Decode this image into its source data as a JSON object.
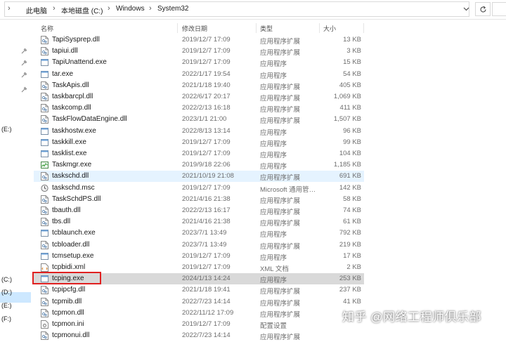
{
  "address": {
    "crumbs": [
      "此电脑",
      "本地磁盘 (C:)",
      "Windows",
      "System32"
    ]
  },
  "columns": {
    "name": "名称",
    "date": "修改日期",
    "type": "类型",
    "size": "大小"
  },
  "drives": [
    "(E:)",
    "(C:)",
    "(D:)",
    "(E:)",
    "(F:)"
  ],
  "files": [
    {
      "name": "TapiSysprep.dll",
      "date": "2019/12/7 17:09",
      "type": "应用程序扩展",
      "size": "13 KB",
      "icon": "dll"
    },
    {
      "name": "tapiui.dll",
      "date": "2019/12/7 17:09",
      "type": "应用程序扩展",
      "size": "3 KB",
      "icon": "dll"
    },
    {
      "name": "TapiUnattend.exe",
      "date": "2019/12/7 17:09",
      "type": "应用程序",
      "size": "15 KB",
      "icon": "exe"
    },
    {
      "name": "tar.exe",
      "date": "2022/1/17 19:54",
      "type": "应用程序",
      "size": "54 KB",
      "icon": "exe"
    },
    {
      "name": "TaskApis.dll",
      "date": "2021/1/18 19:40",
      "type": "应用程序扩展",
      "size": "405 KB",
      "icon": "dll"
    },
    {
      "name": "taskbarcpl.dll",
      "date": "2022/6/17 20:17",
      "type": "应用程序扩展",
      "size": "1,069 KB",
      "icon": "dll"
    },
    {
      "name": "taskcomp.dll",
      "date": "2022/2/13 16:18",
      "type": "应用程序扩展",
      "size": "411 KB",
      "icon": "dll"
    },
    {
      "name": "TaskFlowDataEngine.dll",
      "date": "2023/1/1 21:00",
      "type": "应用程序扩展",
      "size": "1,507 KB",
      "icon": "dll"
    },
    {
      "name": "taskhostw.exe",
      "date": "2022/8/13 13:14",
      "type": "应用程序",
      "size": "96 KB",
      "icon": "exe"
    },
    {
      "name": "taskkill.exe",
      "date": "2019/12/7 17:09",
      "type": "应用程序",
      "size": "99 KB",
      "icon": "exe"
    },
    {
      "name": "tasklist.exe",
      "date": "2019/12/7 17:09",
      "type": "应用程序",
      "size": "104 KB",
      "icon": "exe"
    },
    {
      "name": "Taskmgr.exe",
      "date": "2019/9/18 22:06",
      "type": "应用程序",
      "size": "1,185 KB",
      "icon": "taskmgr"
    },
    {
      "name": "taskschd.dll",
      "date": "2021/10/19 21:08",
      "type": "应用程序扩展",
      "size": "691 KB",
      "icon": "dll",
      "state": "hover"
    },
    {
      "name": "taskschd.msc",
      "date": "2019/12/7 17:09",
      "type": "Microsoft 通用管…",
      "size": "142 KB",
      "icon": "msc"
    },
    {
      "name": "TaskSchdPS.dll",
      "date": "2021/4/16 21:38",
      "type": "应用程序扩展",
      "size": "58 KB",
      "icon": "dll"
    },
    {
      "name": "tbauth.dll",
      "date": "2022/2/13 16:17",
      "type": "应用程序扩展",
      "size": "74 KB",
      "icon": "dll"
    },
    {
      "name": "tbs.dll",
      "date": "2021/4/16 21:38",
      "type": "应用程序扩展",
      "size": "61 KB",
      "icon": "dll"
    },
    {
      "name": "tcblaunch.exe",
      "date": "2023/7/1 13:49",
      "type": "应用程序",
      "size": "792 KB",
      "icon": "exe"
    },
    {
      "name": "tcbloader.dll",
      "date": "2023/7/1 13:49",
      "type": "应用程序扩展",
      "size": "219 KB",
      "icon": "dll"
    },
    {
      "name": "tcmsetup.exe",
      "date": "2019/12/7 17:09",
      "type": "应用程序",
      "size": "17 KB",
      "icon": "exe"
    },
    {
      "name": "tcpbidi.xml",
      "date": "2019/12/7 17:09",
      "type": "XML 文档",
      "size": "2 KB",
      "icon": "xml"
    },
    {
      "name": "tcping.exe",
      "date": "2024/1/13 14:24",
      "type": "应用程序",
      "size": "253 KB",
      "icon": "exe",
      "state": "selected"
    },
    {
      "name": "tcpipcfg.dll",
      "date": "2021/1/18 19:41",
      "type": "应用程序扩展",
      "size": "237 KB",
      "icon": "dll"
    },
    {
      "name": "tcpmib.dll",
      "date": "2022/7/23 14:14",
      "type": "应用程序扩展",
      "size": "41 KB",
      "icon": "dll"
    },
    {
      "name": "tcpmon.dll",
      "date": "2022/11/12 17:09",
      "type": "应用程序扩展",
      "size": "",
      "icon": "dll"
    },
    {
      "name": "tcpmon.ini",
      "date": "2019/12/7 17:09",
      "type": "配置设置",
      "size": "",
      "icon": "ini"
    },
    {
      "name": "tcpmonui.dll",
      "date": "2022/7/23 14:14",
      "type": "应用程序扩展",
      "size": "",
      "icon": "dll"
    }
  ],
  "watermark": "知乎 @网络工程师俱乐部"
}
